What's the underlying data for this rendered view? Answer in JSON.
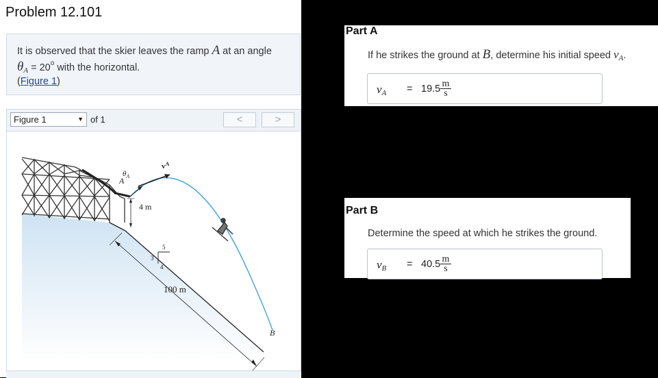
{
  "problem": {
    "title": "Problem 12.101",
    "statement_1": "It is observed that the skier leaves the ramp ",
    "ramp_label": "A",
    "statement_2": " at an angle",
    "theta": "θ",
    "theta_sub": "A",
    "equals_value": " = 20",
    "degree": "o",
    "statement_3": " with the horizontal.",
    "fig_link_open": "(",
    "fig_link": "Figure 1",
    "fig_link_close": ")"
  },
  "figure_viewer": {
    "select_value": "Figure 1",
    "of_label": "of 1",
    "prev": "<",
    "next": ">"
  },
  "figure": {
    "theta_label": "θ",
    "theta_sub": "A",
    "v_label": "v",
    "v_sub": "A",
    "point_a": "A",
    "height": "4 m",
    "slope_5": "5",
    "slope_4": "4",
    "slope_3": "3",
    "distance": "100 m",
    "point_b": "B"
  },
  "partA": {
    "title": "Part A",
    "question_1": "If he strikes the ground at ",
    "question_point": "B",
    "question_2": ", determine his initial speed ",
    "question_var": "v",
    "question_sub": "A",
    "question_end": ".",
    "answer_var": "v",
    "answer_sub": "A",
    "answer_eq": "=",
    "answer_value": "19.5",
    "unit_num": "m",
    "unit_den": "s"
  },
  "partB": {
    "title": "Part B",
    "question": "Determine the speed at which he strikes the ground.",
    "answer_var": "v",
    "answer_sub": "B",
    "answer_eq": "=",
    "answer_value": "40.5",
    "unit_num": "m",
    "unit_den": "s"
  }
}
